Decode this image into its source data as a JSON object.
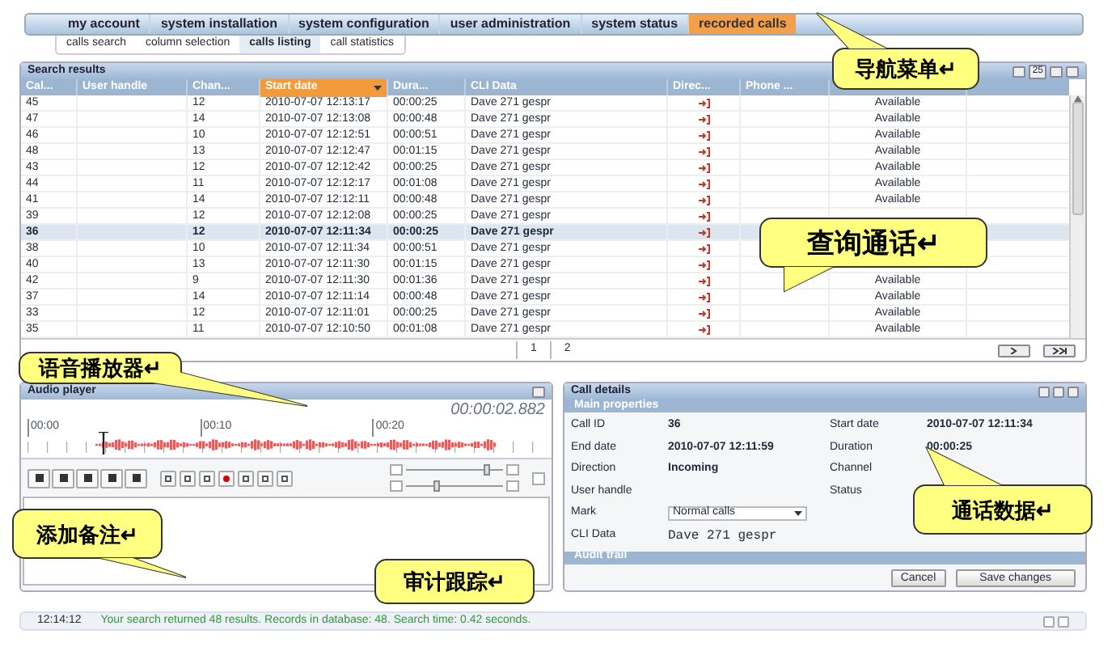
{
  "nav": {
    "tabs": [
      {
        "label": "my account",
        "selected": false
      },
      {
        "label": "system installation",
        "selected": false
      },
      {
        "label": "system configuration",
        "selected": false
      },
      {
        "label": "user administration",
        "selected": false
      },
      {
        "label": "system status",
        "selected": false
      },
      {
        "label": "recorded calls",
        "selected": true
      }
    ],
    "subtabs": [
      {
        "label": "calls search",
        "selected": false
      },
      {
        "label": "column selection",
        "selected": false
      },
      {
        "label": "calls listing",
        "selected": true
      },
      {
        "label": "call statistics",
        "selected": false
      }
    ]
  },
  "search_results": {
    "title": "Search results",
    "page_size": "25",
    "columns": [
      {
        "label": "Cal...",
        "sorted": false
      },
      {
        "label": "User handle",
        "sorted": false
      },
      {
        "label": "Chan...",
        "sorted": false
      },
      {
        "label": "Start date",
        "sorted": true
      },
      {
        "label": "Dura...",
        "sorted": false
      },
      {
        "label": "CLI Data",
        "sorted": false
      },
      {
        "label": "Direc...",
        "sorted": false
      },
      {
        "label": "Phone ...",
        "sorted": false
      }
    ],
    "rows": [
      {
        "call": "45",
        "channel": "12",
        "start": "2010-07-07 12:13:17",
        "duration": "00:00:25",
        "cli": "Dave 271 gespr",
        "status": "Available",
        "selected": false
      },
      {
        "call": "47",
        "channel": "14",
        "start": "2010-07-07 12:13:08",
        "duration": "00:00:48",
        "cli": "Dave 271 gespr",
        "status": "Available",
        "selected": false
      },
      {
        "call": "46",
        "channel": "10",
        "start": "2010-07-07 12:12:51",
        "duration": "00:00:51",
        "cli": "Dave 271 gespr",
        "status": "Available",
        "selected": false
      },
      {
        "call": "48",
        "channel": "13",
        "start": "2010-07-07 12:12:47",
        "duration": "00:01:15",
        "cli": "Dave 271 gespr",
        "status": "Available",
        "selected": false
      },
      {
        "call": "43",
        "channel": "12",
        "start": "2010-07-07 12:12:42",
        "duration": "00:00:25",
        "cli": "Dave 271 gespr",
        "status": "Available",
        "selected": false
      },
      {
        "call": "44",
        "channel": "11",
        "start": "2010-07-07 12:12:17",
        "duration": "00:01:08",
        "cli": "Dave 271 gespr",
        "status": "Available",
        "selected": false
      },
      {
        "call": "41",
        "channel": "14",
        "start": "2010-07-07 12:12:11",
        "duration": "00:00:48",
        "cli": "Dave 271 gespr",
        "status": "Available",
        "selected": false
      },
      {
        "call": "39",
        "channel": "12",
        "start": "2010-07-07 12:12:08",
        "duration": "00:00:25",
        "cli": "Dave 271 gespr",
        "selected": false
      },
      {
        "call": "36",
        "channel": "12",
        "start": "2010-07-07 12:11:34",
        "duration": "00:00:25",
        "cli": "Dave 271 gespr",
        "selected": true
      },
      {
        "call": "38",
        "channel": "10",
        "start": "2010-07-07 12:11:34",
        "duration": "00:00:51",
        "cli": "Dave 271 gespr",
        "selected": false
      },
      {
        "call": "40",
        "channel": "13",
        "start": "2010-07-07 12:11:30",
        "duration": "00:01:15",
        "cli": "Dave 271 gespr",
        "selected": false
      },
      {
        "call": "42",
        "channel": "9",
        "start": "2010-07-07 12:11:30",
        "duration": "00:01:36",
        "cli": "Dave 271 gespr",
        "status": "Available",
        "selected": false
      },
      {
        "call": "37",
        "channel": "14",
        "start": "2010-07-07 12:11:14",
        "duration": "00:00:48",
        "cli": "Dave 271 gespr",
        "status": "Available",
        "selected": false
      },
      {
        "call": "33",
        "channel": "12",
        "start": "2010-07-07 12:11:01",
        "duration": "00:00:25",
        "cli": "Dave 271 gespr",
        "status": "Available",
        "selected": false
      },
      {
        "call": "35",
        "channel": "11",
        "start": "2010-07-07 12:10:50",
        "duration": "00:01:08",
        "cli": "Dave 271 gespr",
        "status": "Available",
        "selected": false
      }
    ],
    "pages": [
      {
        "label": "1",
        "selected": true
      },
      {
        "label": "2",
        "selected": false
      }
    ]
  },
  "audio_player": {
    "title": "Audio player",
    "time": "00:00:02.882",
    "ticks": [
      "00:00",
      "00:10",
      "00:20"
    ],
    "volume": {
      "level": 0.85
    },
    "speed": {
      "level": 0.3
    }
  },
  "call_details": {
    "title": "Call details",
    "main_section": "Main properties",
    "fields": [
      {
        "label": "Call ID",
        "value": "36"
      },
      {
        "label": "Start date",
        "value": "2010-07-07 12:11:34"
      },
      {
        "label": "End date",
        "value": "2010-07-07 12:11:59"
      },
      {
        "label": "Duration",
        "value": "00:00:25"
      },
      {
        "label": "Direction",
        "value": "Incoming"
      },
      {
        "label": "Channel"
      },
      {
        "label": "User handle"
      },
      {
        "label": "Status"
      }
    ],
    "mark": {
      "label": "Mark",
      "value": "Normal calls"
    },
    "cli": {
      "label": "CLI Data",
      "value": "Dave 271 gespr"
    },
    "audit_section": "Audit trail",
    "buttons": [
      "Cancel",
      "Save changes"
    ]
  },
  "status_bar": {
    "time": "12:14:12",
    "message": "Your search returned 48 results. Records in database: 48. Search time: 0.42 seconds."
  },
  "callouts": [
    "导航菜单↵",
    "查询通话↵",
    "语音播放器↵",
    "添加备注↵",
    "审计跟踪↵",
    "通话数据↵"
  ]
}
